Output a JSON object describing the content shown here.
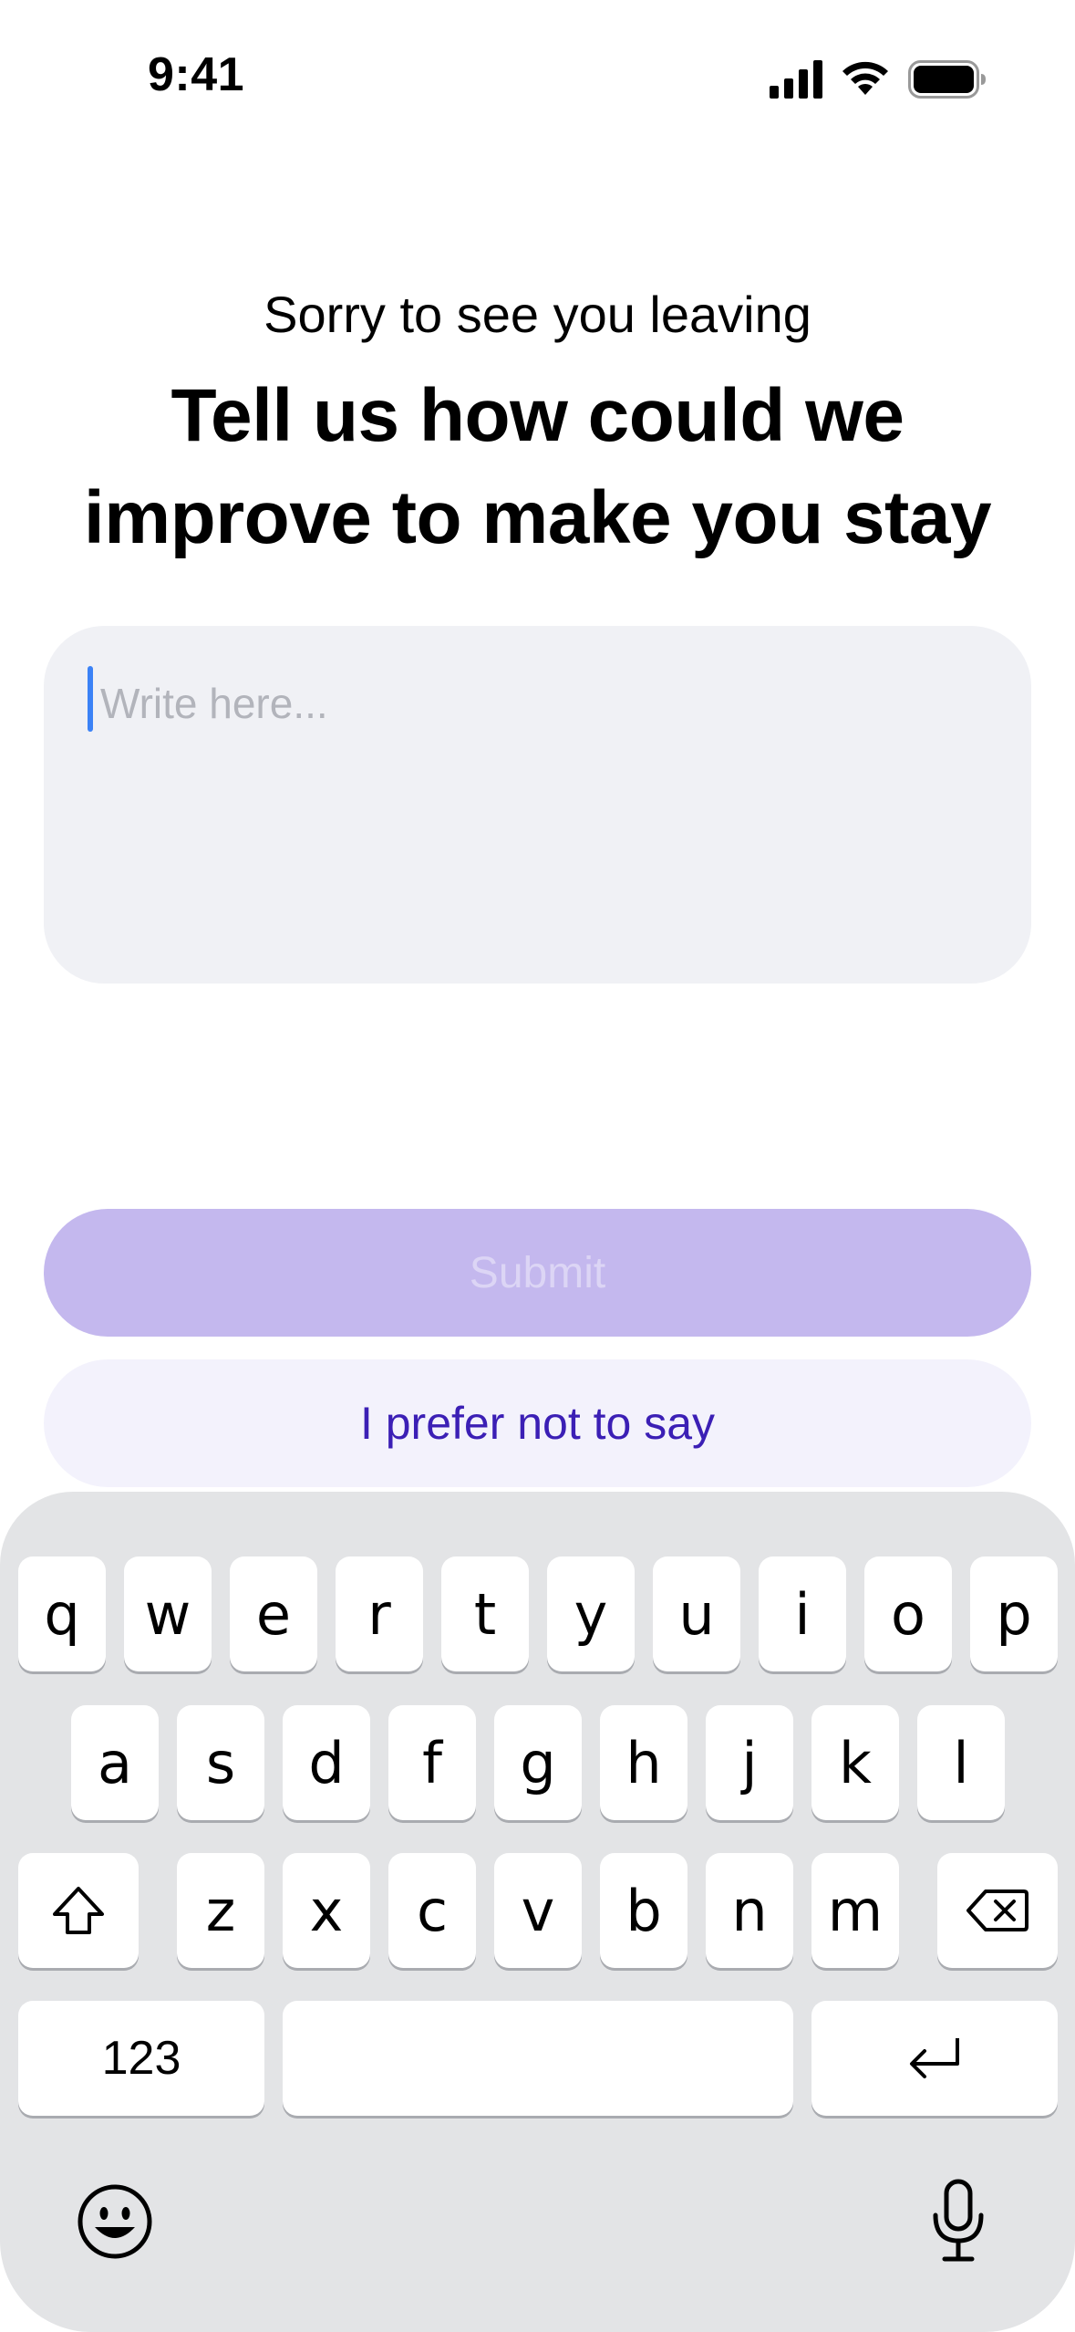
{
  "status_bar": {
    "time": "9:41",
    "icons": [
      "signal-icon",
      "wifi-icon",
      "battery-icon"
    ]
  },
  "header": {
    "subtitle": "Sorry to see you leaving",
    "title_line1": "Tell us how could we",
    "title_line2": "improve to make you stay"
  },
  "feedback": {
    "value": "",
    "placeholder": "Write here..."
  },
  "actions": {
    "submit_label": "Submit",
    "skip_label": "I prefer not to say"
  },
  "keyboard": {
    "row1": [
      "q",
      "w",
      "e",
      "r",
      "t",
      "y",
      "u",
      "i",
      "o",
      "p"
    ],
    "row2": [
      "a",
      "s",
      "d",
      "f",
      "g",
      "h",
      "j",
      "k",
      "l"
    ],
    "row3": [
      "z",
      "x",
      "c",
      "v",
      "b",
      "n",
      "m"
    ],
    "numbers_label": "123",
    "icons": [
      "shift-icon",
      "backspace-icon",
      "return-icon",
      "emoji-icon",
      "microphone-icon"
    ]
  },
  "colors": {
    "accent": "#3b1fb5",
    "submit_disabled_bg": "#c4b8ee",
    "secondary_bg": "#f3f2fc",
    "input_bg": "#f0f1f5",
    "caret": "#3b82f6"
  }
}
